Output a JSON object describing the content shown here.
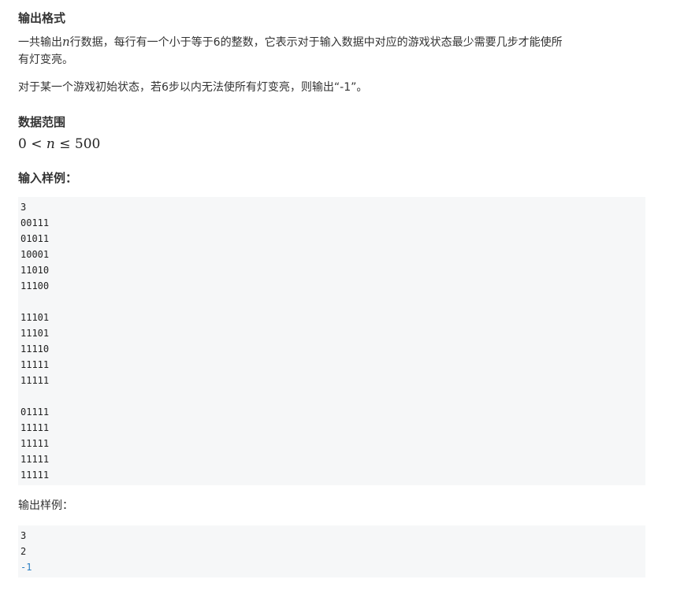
{
  "output_format": {
    "heading": "输出格式",
    "line1_pre": "一共输出",
    "line1_var": "n",
    "line1_post": "行数据，每行有一个小于等于6的整数，它表示对于输入数据中对应的游戏状态最少需要几步才能使所",
    "line1_cont": "有灯变亮。",
    "line2": "对于某一个游戏初始状态，若6步以内无法使所有灯变亮，则输出“-1”。"
  },
  "data_range": {
    "heading": "数据范围",
    "lhs": "0",
    "op1": "<",
    "var": "n",
    "op2": "≤",
    "rhs": "500"
  },
  "input_sample": {
    "heading": "输入样例：",
    "lines": [
      "3",
      "00111",
      "01011",
      "10001",
      "11010",
      "11100",
      "",
      "11101",
      "11101",
      "11110",
      "11111",
      "11111",
      "",
      "01111",
      "11111",
      "11111",
      "11111",
      "11111"
    ]
  },
  "output_sample": {
    "heading": "输出样例：",
    "lines": [
      "3",
      "2",
      "-1"
    ]
  }
}
